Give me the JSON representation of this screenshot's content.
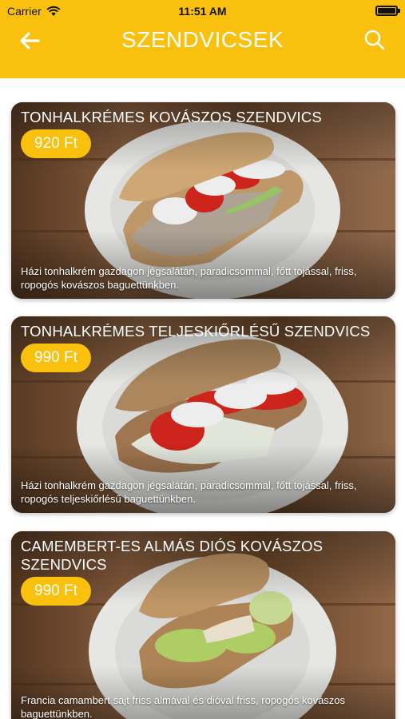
{
  "status_bar": {
    "carrier": "Carrier",
    "time": "11:51 AM"
  },
  "nav": {
    "title": "SZENDVICSEK",
    "back_icon": "back-arrow-icon",
    "search_icon": "search-icon"
  },
  "colors": {
    "accent": "#F9C10E",
    "text_on_accent": "#FFFFFF"
  },
  "products": [
    {
      "title": "TONHALKRÉMES KOVÁSZOS SZENDVICS",
      "price": "920 Ft",
      "description": "Házi tonhalkrém gazdagon jégsalátán, paradicsommal, főtt tojással, friss, ropogós kovászos baguettünkben."
    },
    {
      "title": "TONHALKRÉMES TELJESKIŐRLÉSŰ SZENDVICS",
      "price": "990 Ft",
      "description": "Házi tonhalkrém gazdagon jégsalátán, paradicsommal, főtt tojással, friss, ropogós teljeskiőrlésű baguettünkben."
    },
    {
      "title": "CAMEMBERT-ES ALMÁS DIÓS KOVÁSZOS SZENDVICS",
      "price": "990 Ft",
      "description": "Francia camambert sajt friss almával és dióval friss, ropogós kovászos baguettünkben."
    }
  ]
}
